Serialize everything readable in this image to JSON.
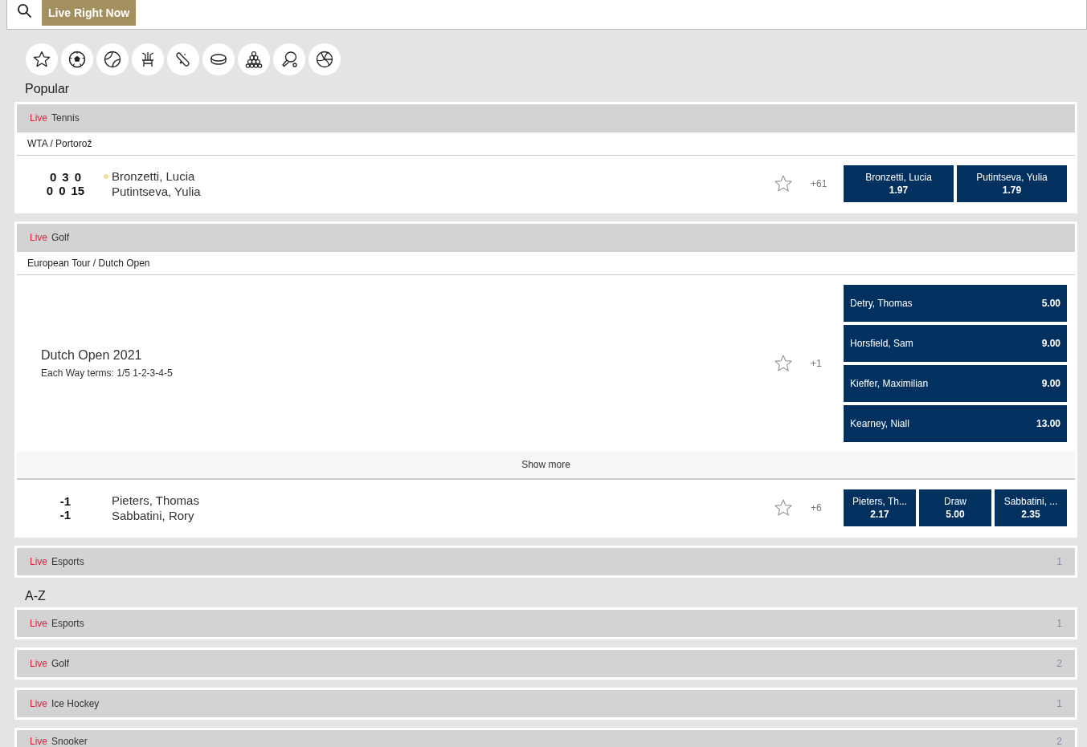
{
  "search": {
    "tab": {
      "label": "Live Right Now",
      "selected": true
    }
  },
  "popular": {
    "heading": "Popular",
    "groups": [
      {
        "live": "Live",
        "sport": "Tennis",
        "competitions": [
          {
            "name": "WTA / Portorož",
            "events": [
              {
                "kind": "match",
                "scores": [
                  [
                    "0",
                    "3",
                    "0"
                  ],
                  [
                    "0",
                    "0",
                    "15"
                  ]
                ],
                "players": [
                  {
                    "name": "Bronzetti, Lucia",
                    "serving": true
                  },
                  {
                    "name": "Putintseva, Yulia",
                    "serving": false
                  }
                ],
                "more": "+61",
                "odds": [
                  {
                    "label": "Bronzetti, Lucia",
                    "price": "1.97"
                  },
                  {
                    "label": "Putintseva, Yulia",
                    "price": "1.79"
                  }
                ]
              }
            ]
          }
        ]
      },
      {
        "live": "Live",
        "sport": "Golf",
        "competitions": [
          {
            "name": "European Tour / Dutch Open",
            "events": [
              {
                "kind": "outright",
                "title": "Dutch Open 2021",
                "terms": "Each Way terms: 1/5 1-2-3-4-5",
                "more": "+1",
                "selections": [
                  {
                    "name": "Detry, Thomas",
                    "price": "5.00"
                  },
                  {
                    "name": "Horsfield, Sam",
                    "price": "9.00"
                  },
                  {
                    "name": "Kieffer, Maximilian",
                    "price": "9.00"
                  },
                  {
                    "name": "Kearney, Niall",
                    "price": "13.00"
                  }
                ],
                "show_more": "Show more"
              },
              {
                "kind": "match",
                "scores": [
                  [
                    "-1"
                  ],
                  [
                    "-1"
                  ]
                ],
                "players": [
                  {
                    "name": "Pieters, Thomas",
                    "serving": false
                  },
                  {
                    "name": "Sabbatini, Rory",
                    "serving": false
                  }
                ],
                "more": "+6",
                "odds": [
                  {
                    "label": "Pieters, Th...",
                    "price": "2.17"
                  },
                  {
                    "label": "Draw",
                    "price": "5.00"
                  },
                  {
                    "label": "Sabbatini, ...",
                    "price": "2.35"
                  }
                ]
              }
            ]
          }
        ]
      },
      {
        "live": "Live",
        "sport": "Esports",
        "count": "1"
      }
    ]
  },
  "a_z": {
    "heading": "A-Z",
    "groups": [
      {
        "live": "Live",
        "sport": "Esports",
        "count": "1"
      },
      {
        "live": "Live",
        "sport": "Golf",
        "count": "2"
      },
      {
        "live": "Live",
        "sport": "Ice Hockey",
        "count": "1"
      },
      {
        "live": "Live",
        "sport": "Snooker",
        "count": "2"
      }
    ]
  }
}
